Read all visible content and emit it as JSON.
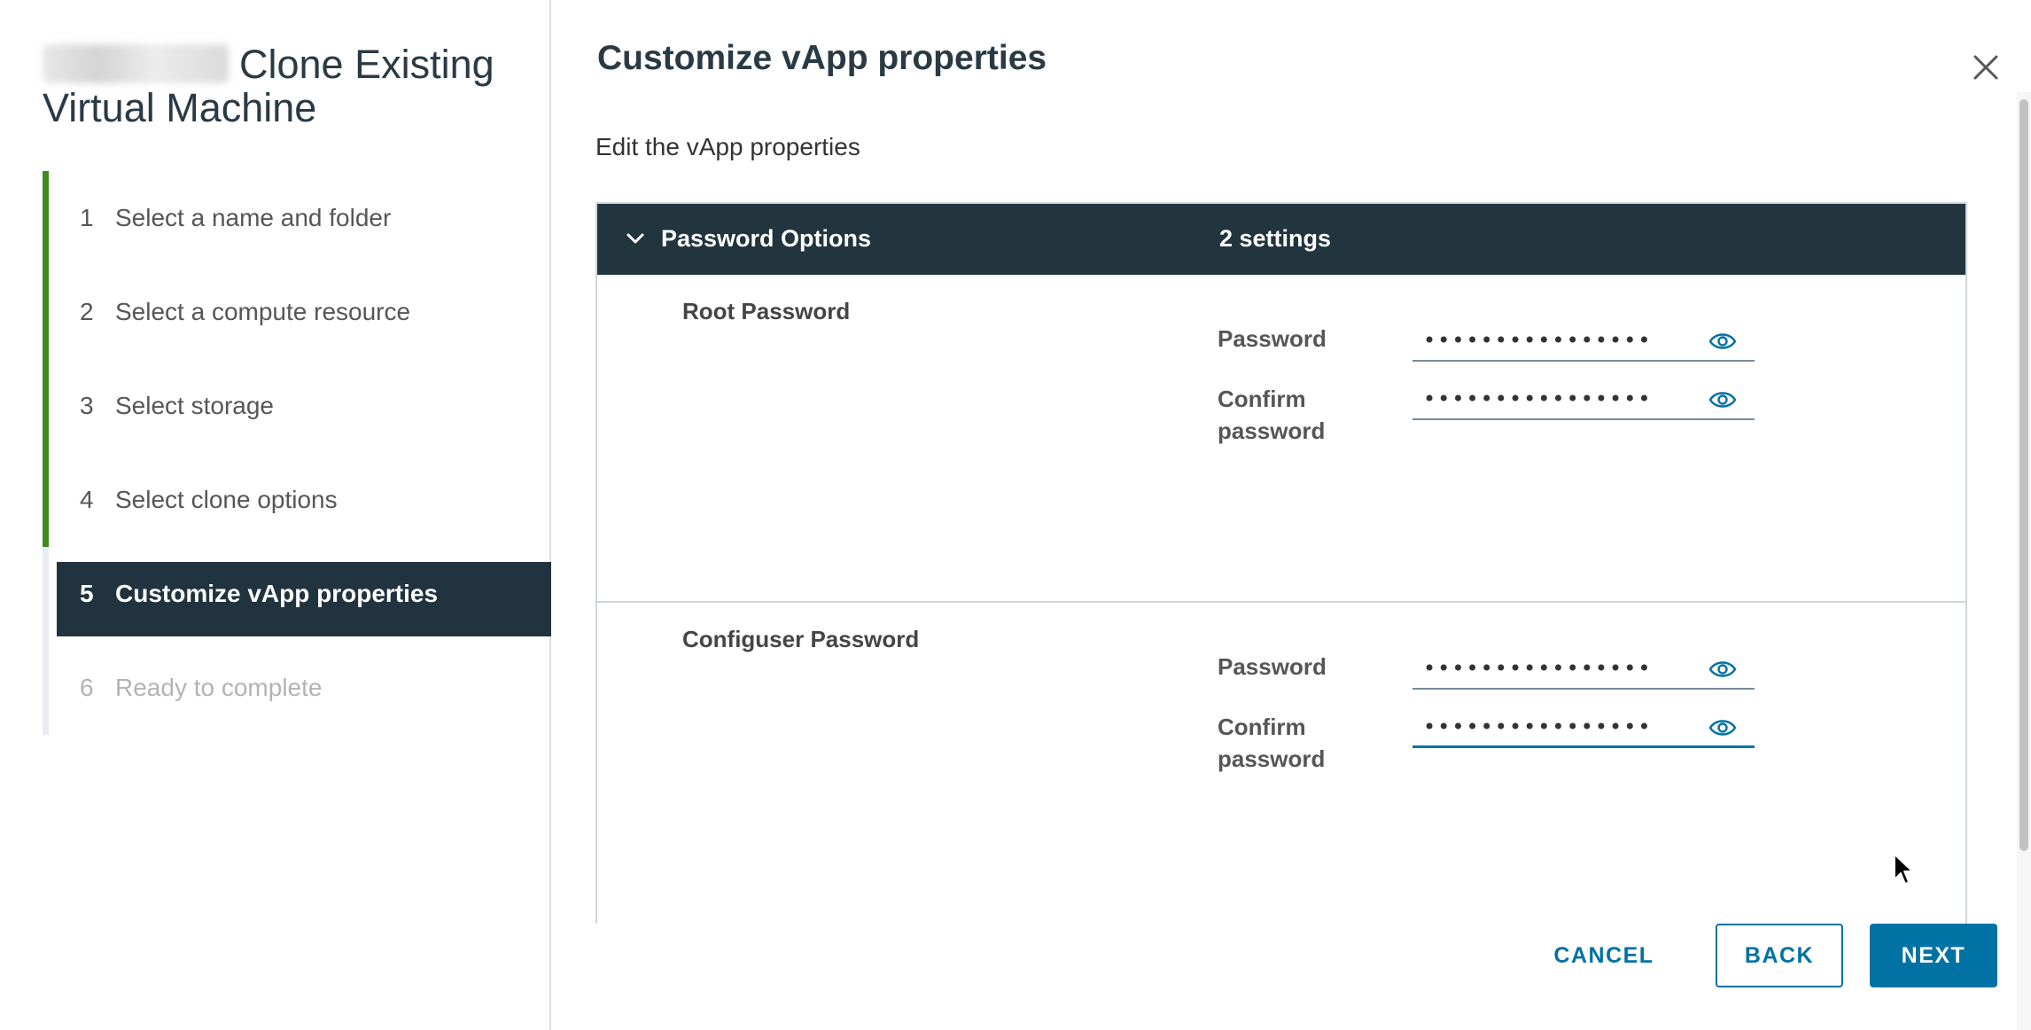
{
  "wizard": {
    "title": "Clone Existing Virtual Machine"
  },
  "steps": [
    {
      "num": "1",
      "label": "Select a name and folder"
    },
    {
      "num": "2",
      "label": "Select a compute resource"
    },
    {
      "num": "3",
      "label": "Select storage"
    },
    {
      "num": "4",
      "label": "Select clone options"
    },
    {
      "num": "5",
      "label": "Customize vApp properties"
    },
    {
      "num": "6",
      "label": "Ready to complete"
    }
  ],
  "page": {
    "title": "Customize vApp properties",
    "subtitle": "Edit the vApp properties"
  },
  "panel": {
    "title": "Password Options",
    "count": "2 settings",
    "groups": [
      {
        "title": "Root Password",
        "password_label": "Password",
        "password_value": "••••••••••••••••",
        "confirm_label": "Confirm password",
        "confirm_value": "••••••••••••••••"
      },
      {
        "title": "Configuser Password",
        "password_label": "Password",
        "password_value": "••••••••••••••••",
        "confirm_label": "Confirm password",
        "confirm_value": "••••••••••••••••"
      }
    ]
  },
  "footer": {
    "cancel": "CANCEL",
    "back": "BACK",
    "next": "NEXT"
  },
  "icons": {
    "close": "close-icon",
    "collapse": "chevron-down-icon",
    "show_password": "eye-icon"
  },
  "colors": {
    "primary": "#0072a3",
    "header_dark": "#22343e",
    "step_complete": "#3f8a1f"
  }
}
